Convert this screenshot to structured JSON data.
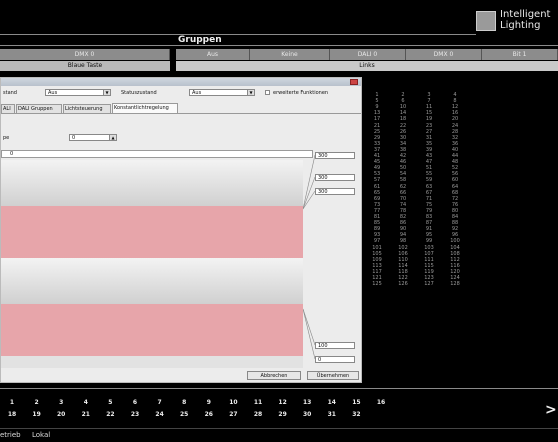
{
  "brand": {
    "line1": "Intelligent",
    "line2": "Lighting"
  },
  "groups_title": "Gruppen",
  "columns": [
    {
      "label": "DMX 0",
      "sub": "Blaue Taste"
    },
    {
      "label": "Aus",
      "sub": ""
    },
    {
      "label": "Keine",
      "sub": ""
    },
    {
      "label": "DALI 0",
      "sub": "Links"
    },
    {
      "label": "DMX 0",
      "sub": ""
    },
    {
      "label": "Bit 1",
      "sub": ""
    }
  ],
  "dialog": {
    "status_label": "stand",
    "status_value": "Aus",
    "state_label": "Statuszustand",
    "state_value": "Aus",
    "advanced_label": "erweiterte Funktionen",
    "tabs": [
      "ALI",
      "DALI Gruppen",
      "Lichtsteuerung",
      "Konstantlichtregelung"
    ],
    "field_label": "pe",
    "field_value": "0",
    "first_value": "0",
    "side_values": [
      "300",
      "300",
      "300",
      "100",
      "0"
    ],
    "ok_label": "Abbrechen",
    "cancel_label": "Übernehmen"
  },
  "grid_numbers": [
    [
      "1",
      "2",
      "3",
      "4"
    ],
    [
      "5",
      "6",
      "7",
      "8"
    ],
    [
      "9",
      "10",
      "11",
      "12"
    ],
    [
      "13",
      "14",
      "15",
      "16"
    ],
    [
      "17",
      "18",
      "19",
      "20"
    ],
    [
      "21",
      "22",
      "23",
      "24"
    ],
    [
      "25",
      "26",
      "27",
      "28"
    ],
    [
      "29",
      "30",
      "31",
      "32"
    ],
    [
      "33",
      "34",
      "35",
      "36"
    ],
    [
      "37",
      "38",
      "39",
      "40"
    ],
    [
      "41",
      "42",
      "43",
      "44"
    ],
    [
      "45",
      "46",
      "47",
      "48"
    ],
    [
      "49",
      "50",
      "51",
      "52"
    ],
    [
      "53",
      "54",
      "55",
      "56"
    ],
    [
      "57",
      "58",
      "59",
      "60"
    ],
    [
      "61",
      "62",
      "63",
      "64"
    ],
    [
      "65",
      "66",
      "67",
      "68"
    ],
    [
      "69",
      "70",
      "71",
      "72"
    ],
    [
      "73",
      "74",
      "75",
      "76"
    ],
    [
      "77",
      "78",
      "79",
      "80"
    ],
    [
      "81",
      "82",
      "83",
      "84"
    ],
    [
      "85",
      "86",
      "87",
      "88"
    ],
    [
      "89",
      "90",
      "91",
      "92"
    ],
    [
      "93",
      "94",
      "95",
      "96"
    ],
    [
      "97",
      "98",
      "99",
      "100"
    ],
    [
      "101",
      "102",
      "103",
      "104"
    ],
    [
      "105",
      "106",
      "107",
      "108"
    ],
    [
      "109",
      "110",
      "111",
      "112"
    ],
    [
      "113",
      "114",
      "115",
      "116"
    ],
    [
      "117",
      "118",
      "119",
      "120"
    ],
    [
      "121",
      "122",
      "123",
      "124"
    ],
    [
      "125",
      "126",
      "127",
      "128"
    ]
  ],
  "bottom_row1": [
    "1",
    "2",
    "3",
    "4",
    "5",
    "6",
    "7",
    "8",
    "9",
    "10",
    "11",
    "12",
    "13",
    "14",
    "15",
    "16"
  ],
  "bottom_row2": [
    "18",
    "19",
    "20",
    "21",
    "22",
    "23",
    "24",
    "25",
    "26",
    "27",
    "28",
    "29",
    "30",
    "31",
    "32"
  ],
  "next_arrow": ">",
  "status_bar": {
    "mode": "etrieb",
    "location": "Lokal"
  },
  "colors": {
    "pink": "#e7a5aa",
    "grey": "#d9d9d9",
    "header": "#8c8c8c"
  }
}
